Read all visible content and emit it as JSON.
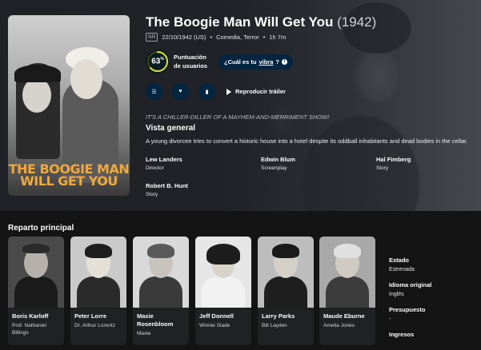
{
  "movie": {
    "title": "The Boogie Man Will Get You",
    "year": "(1942)",
    "certification": "NR",
    "release": "22/10/1942 (US)",
    "genres": "Comedia, Terror",
    "runtime": "1h 7m",
    "poster_title": "THE BOOGIE MAN WILL GET YOU",
    "score": "63",
    "score_fraction": 0.63,
    "score_percent_sign": "%",
    "score_label": "Puntuación de usuarios",
    "vibe_prefix": "¿Cuál es tu ",
    "vibe_link": "vibra",
    "vibe_suffix": "?",
    "trailer": "Reproducir tráiler",
    "tagline": "IT'S A CHILLER-DILLER OF A MAYHEM-AND-MERRIMENT SHOW!",
    "overview_heading": "Vista general",
    "overview": "A young divorcee tries to convert a historic house into a hotel despite its oddball inhabitants and dead bodies in the cellar."
  },
  "crew": [
    {
      "name": "Lew Landers",
      "job": "Director"
    },
    {
      "name": "Edwin Blum",
      "job": "Screenplay"
    },
    {
      "name": "Hal Fimberg",
      "job": "Story"
    },
    {
      "name": "Robert B. Hunt",
      "job": "Story"
    }
  ],
  "cast_heading": "Reparto principal",
  "cast": [
    {
      "name": "Boris Karloff",
      "character": "Prof. Nathaniel Billings"
    },
    {
      "name": "Peter Lorre",
      "character": "Dr. Arthur Lorentz"
    },
    {
      "name": "Maxie Rosenbloom",
      "character": "Maxie"
    },
    {
      "name": "Jeff Donnell",
      "character": "Winnie Slade"
    },
    {
      "name": "Larry Parks",
      "character": "Bill Layden"
    },
    {
      "name": "Maude Eburne",
      "character": "Amelia Jones"
    }
  ],
  "side_facts": [
    {
      "label": "Estado",
      "value": "Estrenada"
    },
    {
      "label": "Idioma original",
      "value": "Inglés"
    },
    {
      "label": "Presupuesto",
      "value": "-"
    },
    {
      "label": "Ingresos",
      "value": ""
    }
  ],
  "colors": {
    "score_ring": "#d2d531",
    "score_track": "#423d0f",
    "poster_title": "#f0a93a",
    "button_bg": "#032541"
  }
}
